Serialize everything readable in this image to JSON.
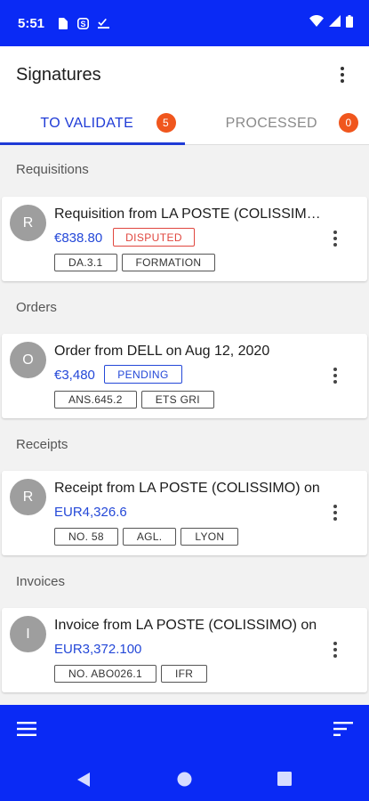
{
  "status_bar": {
    "time": "5:51",
    "icons_left": [
      "sim-card-icon",
      "s-logo-icon",
      "check-list-icon"
    ],
    "icons_right": [
      "wifi-icon",
      "signal-icon",
      "battery-icon"
    ]
  },
  "app_bar": {
    "title": "Signatures",
    "menu_icon": "more-vert-icon"
  },
  "tabs": [
    {
      "label": "TO VALIDATE",
      "count": "5",
      "active": true
    },
    {
      "label": "PROCESSED",
      "count": "0",
      "active": false
    }
  ],
  "sections": [
    {
      "title": "Requisitions",
      "item": {
        "avatar": "R",
        "title": "Requisition from LA POSTE (COLISSIMO)",
        "amount": "€838.80",
        "status": "DISPUTED",
        "tags": [
          "DA.3.1",
          "FORMATION"
        ]
      }
    },
    {
      "title": "Orders",
      "item": {
        "avatar": "O",
        "title": "Order from DELL on Aug 12, 2020",
        "amount": "€3,480",
        "status": "PENDING",
        "tags": [
          "ANS.645.2",
          "ETS GRI"
        ]
      }
    },
    {
      "title": "Receipts",
      "item": {
        "avatar": "R",
        "title": "Receipt from LA POSTE (COLISSIMO) on",
        "amount": "EUR4,326.6",
        "status": "",
        "tags": [
          "NO. 58",
          "AGL.",
          "LYON"
        ]
      }
    },
    {
      "title": "Invoices",
      "item": {
        "avatar": "I",
        "title": "Invoice from LA POSTE (COLISSIMO) on",
        "amount": "EUR3,372.100",
        "status": "",
        "tags": [
          "NO. ABO026.1",
          "IFR"
        ]
      }
    }
  ],
  "bottom_bar": {
    "left_icon": "menu-icon",
    "right_icon": "sort-icon"
  },
  "nav_bar": {
    "icons": [
      "back-icon",
      "home-icon",
      "recents-icon"
    ]
  },
  "colors": {
    "primary": "#0a2af5",
    "accent": "#2448d8",
    "badge": "#f0561d",
    "disputed": "#e0463e"
  }
}
